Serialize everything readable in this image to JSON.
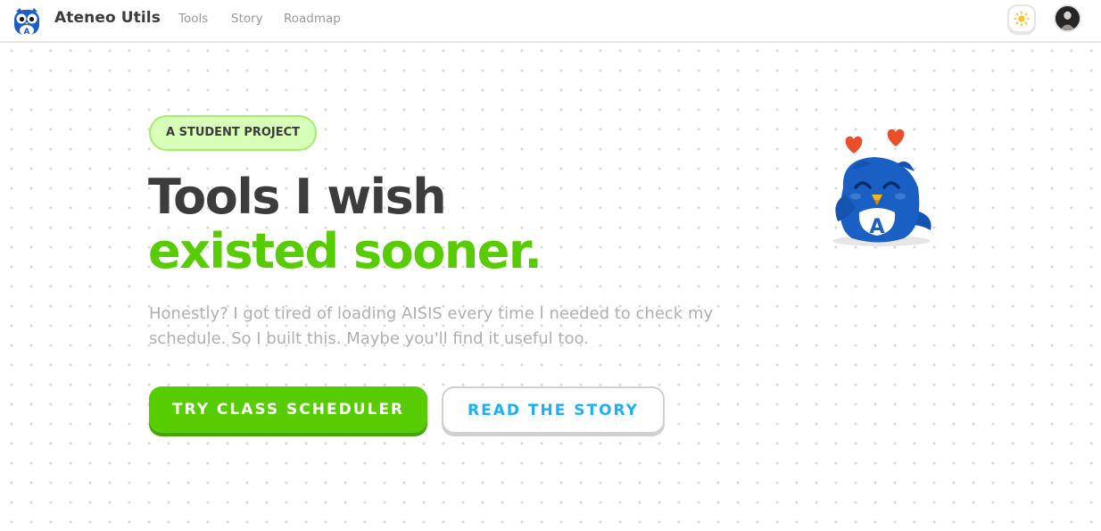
{
  "nav": {
    "brand": "Ateneo Utils",
    "links": [
      "Tools",
      "Story",
      "Roadmap"
    ],
    "logo_icon": "owl-logo-icon",
    "theme_icon": "sun-icon",
    "avatar_icon": "user-avatar"
  },
  "hero": {
    "badge": "A STUDENT PROJECT",
    "headline_line1": "Tools I wish",
    "headline_line2": "existed sooner.",
    "subtext": "Honestly? I got tired of loading AISIS every time I needed to check my schedule. So I built this. Maybe you'll find it useful too.",
    "primary_button": "TRY CLASS SCHEDULER",
    "secondary_button": "READ THE STORY",
    "mascot_icon": "owl-mascot-with-hearts"
  },
  "colors": {
    "green": "#58cc02",
    "green_dark": "#46a302",
    "blue": "#1cb0f6",
    "badge_bg": "#d7ffb8",
    "badge_border": "#a5ed6e",
    "text_dark": "#3c3c3c",
    "text_muted": "#afafaf",
    "owl_blue": "#1a5fc4",
    "heart_red": "#ea4e2a"
  }
}
